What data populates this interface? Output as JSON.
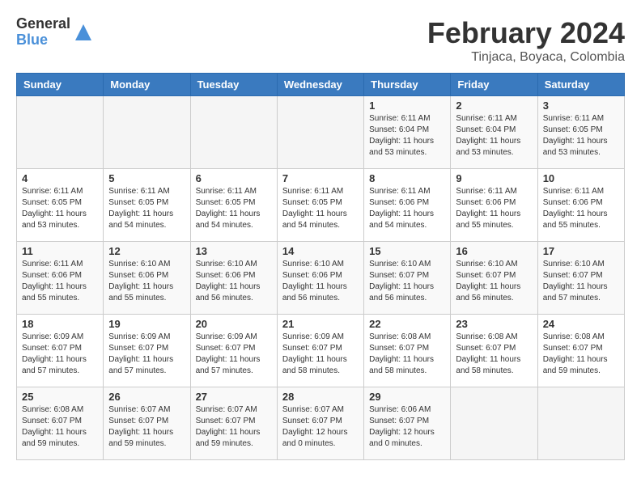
{
  "logo": {
    "line1": "General",
    "line2": "Blue"
  },
  "title": "February 2024",
  "subtitle": "Tinjaca, Boyaca, Colombia",
  "header": {
    "accent_color": "#3a7abf"
  },
  "days_of_week": [
    "Sunday",
    "Monday",
    "Tuesday",
    "Wednesday",
    "Thursday",
    "Friday",
    "Saturday"
  ],
  "weeks": [
    [
      {
        "day": "",
        "info": ""
      },
      {
        "day": "",
        "info": ""
      },
      {
        "day": "",
        "info": ""
      },
      {
        "day": "",
        "info": ""
      },
      {
        "day": "1",
        "info": "Sunrise: 6:11 AM\nSunset: 6:04 PM\nDaylight: 11 hours\nand 53 minutes."
      },
      {
        "day": "2",
        "info": "Sunrise: 6:11 AM\nSunset: 6:04 PM\nDaylight: 11 hours\nand 53 minutes."
      },
      {
        "day": "3",
        "info": "Sunrise: 6:11 AM\nSunset: 6:05 PM\nDaylight: 11 hours\nand 53 minutes."
      }
    ],
    [
      {
        "day": "4",
        "info": "Sunrise: 6:11 AM\nSunset: 6:05 PM\nDaylight: 11 hours\nand 53 minutes."
      },
      {
        "day": "5",
        "info": "Sunrise: 6:11 AM\nSunset: 6:05 PM\nDaylight: 11 hours\nand 54 minutes."
      },
      {
        "day": "6",
        "info": "Sunrise: 6:11 AM\nSunset: 6:05 PM\nDaylight: 11 hours\nand 54 minutes."
      },
      {
        "day": "7",
        "info": "Sunrise: 6:11 AM\nSunset: 6:05 PM\nDaylight: 11 hours\nand 54 minutes."
      },
      {
        "day": "8",
        "info": "Sunrise: 6:11 AM\nSunset: 6:06 PM\nDaylight: 11 hours\nand 54 minutes."
      },
      {
        "day": "9",
        "info": "Sunrise: 6:11 AM\nSunset: 6:06 PM\nDaylight: 11 hours\nand 55 minutes."
      },
      {
        "day": "10",
        "info": "Sunrise: 6:11 AM\nSunset: 6:06 PM\nDaylight: 11 hours\nand 55 minutes."
      }
    ],
    [
      {
        "day": "11",
        "info": "Sunrise: 6:11 AM\nSunset: 6:06 PM\nDaylight: 11 hours\nand 55 minutes."
      },
      {
        "day": "12",
        "info": "Sunrise: 6:10 AM\nSunset: 6:06 PM\nDaylight: 11 hours\nand 55 minutes."
      },
      {
        "day": "13",
        "info": "Sunrise: 6:10 AM\nSunset: 6:06 PM\nDaylight: 11 hours\nand 56 minutes."
      },
      {
        "day": "14",
        "info": "Sunrise: 6:10 AM\nSunset: 6:06 PM\nDaylight: 11 hours\nand 56 minutes."
      },
      {
        "day": "15",
        "info": "Sunrise: 6:10 AM\nSunset: 6:07 PM\nDaylight: 11 hours\nand 56 minutes."
      },
      {
        "day": "16",
        "info": "Sunrise: 6:10 AM\nSunset: 6:07 PM\nDaylight: 11 hours\nand 56 minutes."
      },
      {
        "day": "17",
        "info": "Sunrise: 6:10 AM\nSunset: 6:07 PM\nDaylight: 11 hours\nand 57 minutes."
      }
    ],
    [
      {
        "day": "18",
        "info": "Sunrise: 6:09 AM\nSunset: 6:07 PM\nDaylight: 11 hours\nand 57 minutes."
      },
      {
        "day": "19",
        "info": "Sunrise: 6:09 AM\nSunset: 6:07 PM\nDaylight: 11 hours\nand 57 minutes."
      },
      {
        "day": "20",
        "info": "Sunrise: 6:09 AM\nSunset: 6:07 PM\nDaylight: 11 hours\nand 57 minutes."
      },
      {
        "day": "21",
        "info": "Sunrise: 6:09 AM\nSunset: 6:07 PM\nDaylight: 11 hours\nand 58 minutes."
      },
      {
        "day": "22",
        "info": "Sunrise: 6:08 AM\nSunset: 6:07 PM\nDaylight: 11 hours\nand 58 minutes."
      },
      {
        "day": "23",
        "info": "Sunrise: 6:08 AM\nSunset: 6:07 PM\nDaylight: 11 hours\nand 58 minutes."
      },
      {
        "day": "24",
        "info": "Sunrise: 6:08 AM\nSunset: 6:07 PM\nDaylight: 11 hours\nand 59 minutes."
      }
    ],
    [
      {
        "day": "25",
        "info": "Sunrise: 6:08 AM\nSunset: 6:07 PM\nDaylight: 11 hours\nand 59 minutes."
      },
      {
        "day": "26",
        "info": "Sunrise: 6:07 AM\nSunset: 6:07 PM\nDaylight: 11 hours\nand 59 minutes."
      },
      {
        "day": "27",
        "info": "Sunrise: 6:07 AM\nSunset: 6:07 PM\nDaylight: 11 hours\nand 59 minutes."
      },
      {
        "day": "28",
        "info": "Sunrise: 6:07 AM\nSunset: 6:07 PM\nDaylight: 12 hours\nand 0 minutes."
      },
      {
        "day": "29",
        "info": "Sunrise: 6:06 AM\nSunset: 6:07 PM\nDaylight: 12 hours\nand 0 minutes."
      },
      {
        "day": "",
        "info": ""
      },
      {
        "day": "",
        "info": ""
      }
    ]
  ]
}
